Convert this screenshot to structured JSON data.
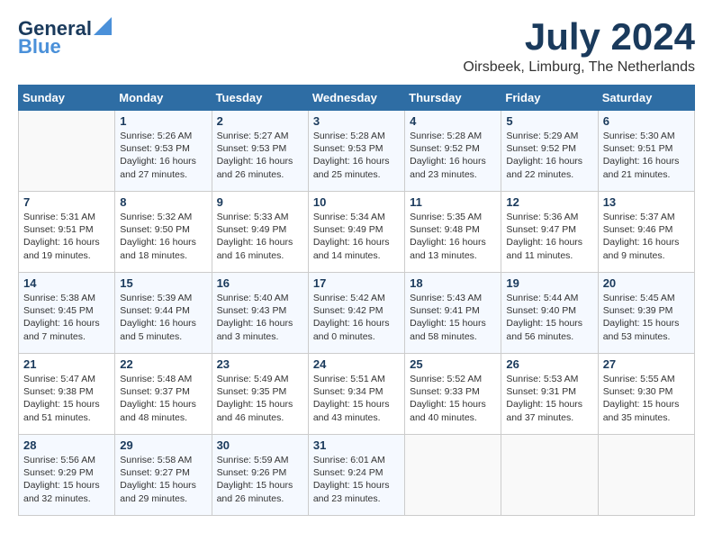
{
  "header": {
    "logo_line1": "General",
    "logo_line2": "Blue",
    "month_year": "July 2024",
    "location": "Oirsbeek, Limburg, The Netherlands"
  },
  "weekdays": [
    "Sunday",
    "Monday",
    "Tuesday",
    "Wednesday",
    "Thursday",
    "Friday",
    "Saturday"
  ],
  "weeks": [
    [
      {
        "day": "",
        "info": ""
      },
      {
        "day": "1",
        "info": "Sunrise: 5:26 AM\nSunset: 9:53 PM\nDaylight: 16 hours\nand 27 minutes."
      },
      {
        "day": "2",
        "info": "Sunrise: 5:27 AM\nSunset: 9:53 PM\nDaylight: 16 hours\nand 26 minutes."
      },
      {
        "day": "3",
        "info": "Sunrise: 5:28 AM\nSunset: 9:53 PM\nDaylight: 16 hours\nand 25 minutes."
      },
      {
        "day": "4",
        "info": "Sunrise: 5:28 AM\nSunset: 9:52 PM\nDaylight: 16 hours\nand 23 minutes."
      },
      {
        "day": "5",
        "info": "Sunrise: 5:29 AM\nSunset: 9:52 PM\nDaylight: 16 hours\nand 22 minutes."
      },
      {
        "day": "6",
        "info": "Sunrise: 5:30 AM\nSunset: 9:51 PM\nDaylight: 16 hours\nand 21 minutes."
      }
    ],
    [
      {
        "day": "7",
        "info": "Sunrise: 5:31 AM\nSunset: 9:51 PM\nDaylight: 16 hours\nand 19 minutes."
      },
      {
        "day": "8",
        "info": "Sunrise: 5:32 AM\nSunset: 9:50 PM\nDaylight: 16 hours\nand 18 minutes."
      },
      {
        "day": "9",
        "info": "Sunrise: 5:33 AM\nSunset: 9:49 PM\nDaylight: 16 hours\nand 16 minutes."
      },
      {
        "day": "10",
        "info": "Sunrise: 5:34 AM\nSunset: 9:49 PM\nDaylight: 16 hours\nand 14 minutes."
      },
      {
        "day": "11",
        "info": "Sunrise: 5:35 AM\nSunset: 9:48 PM\nDaylight: 16 hours\nand 13 minutes."
      },
      {
        "day": "12",
        "info": "Sunrise: 5:36 AM\nSunset: 9:47 PM\nDaylight: 16 hours\nand 11 minutes."
      },
      {
        "day": "13",
        "info": "Sunrise: 5:37 AM\nSunset: 9:46 PM\nDaylight: 16 hours\nand 9 minutes."
      }
    ],
    [
      {
        "day": "14",
        "info": "Sunrise: 5:38 AM\nSunset: 9:45 PM\nDaylight: 16 hours\nand 7 minutes."
      },
      {
        "day": "15",
        "info": "Sunrise: 5:39 AM\nSunset: 9:44 PM\nDaylight: 16 hours\nand 5 minutes."
      },
      {
        "day": "16",
        "info": "Sunrise: 5:40 AM\nSunset: 9:43 PM\nDaylight: 16 hours\nand 3 minutes."
      },
      {
        "day": "17",
        "info": "Sunrise: 5:42 AM\nSunset: 9:42 PM\nDaylight: 16 hours\nand 0 minutes."
      },
      {
        "day": "18",
        "info": "Sunrise: 5:43 AM\nSunset: 9:41 PM\nDaylight: 15 hours\nand 58 minutes."
      },
      {
        "day": "19",
        "info": "Sunrise: 5:44 AM\nSunset: 9:40 PM\nDaylight: 15 hours\nand 56 minutes."
      },
      {
        "day": "20",
        "info": "Sunrise: 5:45 AM\nSunset: 9:39 PM\nDaylight: 15 hours\nand 53 minutes."
      }
    ],
    [
      {
        "day": "21",
        "info": "Sunrise: 5:47 AM\nSunset: 9:38 PM\nDaylight: 15 hours\nand 51 minutes."
      },
      {
        "day": "22",
        "info": "Sunrise: 5:48 AM\nSunset: 9:37 PM\nDaylight: 15 hours\nand 48 minutes."
      },
      {
        "day": "23",
        "info": "Sunrise: 5:49 AM\nSunset: 9:35 PM\nDaylight: 15 hours\nand 46 minutes."
      },
      {
        "day": "24",
        "info": "Sunrise: 5:51 AM\nSunset: 9:34 PM\nDaylight: 15 hours\nand 43 minutes."
      },
      {
        "day": "25",
        "info": "Sunrise: 5:52 AM\nSunset: 9:33 PM\nDaylight: 15 hours\nand 40 minutes."
      },
      {
        "day": "26",
        "info": "Sunrise: 5:53 AM\nSunset: 9:31 PM\nDaylight: 15 hours\nand 37 minutes."
      },
      {
        "day": "27",
        "info": "Sunrise: 5:55 AM\nSunset: 9:30 PM\nDaylight: 15 hours\nand 35 minutes."
      }
    ],
    [
      {
        "day": "28",
        "info": "Sunrise: 5:56 AM\nSunset: 9:29 PM\nDaylight: 15 hours\nand 32 minutes."
      },
      {
        "day": "29",
        "info": "Sunrise: 5:58 AM\nSunset: 9:27 PM\nDaylight: 15 hours\nand 29 minutes."
      },
      {
        "day": "30",
        "info": "Sunrise: 5:59 AM\nSunset: 9:26 PM\nDaylight: 15 hours\nand 26 minutes."
      },
      {
        "day": "31",
        "info": "Sunrise: 6:01 AM\nSunset: 9:24 PM\nDaylight: 15 hours\nand 23 minutes."
      },
      {
        "day": "",
        "info": ""
      },
      {
        "day": "",
        "info": ""
      },
      {
        "day": "",
        "info": ""
      }
    ]
  ]
}
